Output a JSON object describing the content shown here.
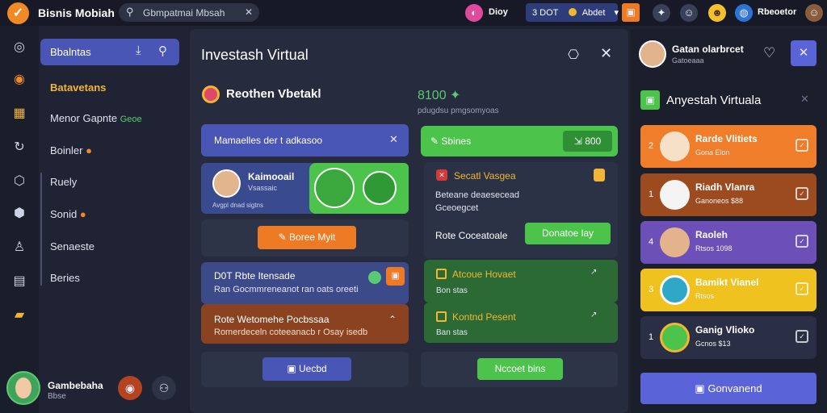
{
  "topbar": {
    "app_title": "Bisnis Mobiah",
    "search_text": "Gbmpatmai Mbsah",
    "user_label": "Dioy",
    "pill_text": "3 DOT",
    "pill_value": "Abdet",
    "right_name": "Rbeoetor"
  },
  "sidebar": {
    "header_label": "Bbalntas",
    "section_title": "Batavetans",
    "items": [
      "Menor Gapnte",
      "Boinler",
      "Ruely",
      "Sonid",
      "Senaeste",
      "Beries"
    ],
    "badge": "Geoe",
    "user_name": "Gambebaha",
    "user_sub": "Bbse"
  },
  "main": {
    "title": "Investash Virtual",
    "subtitle": "Reothen Vbetakl",
    "amount": "8100",
    "amount_sub": "pdugdsu pmgsomyoas",
    "left": {
      "banner": "Mamaelles der t adkasoo",
      "profile_name": "Kaimooail",
      "profile_sub": "Vsassaic",
      "profile_caption": "Avgpl dnad sigtns",
      "orange_button": "Boree Myit",
      "item1_title": "D0T Rbte Itensade",
      "item1_sub": "Ran Gocmmreneanot ran oats oreeti",
      "item2_title": "Rote Wetomehe Pocbssaa",
      "item2_sub": "Romerdeceln coteeanacb r Osay isedb",
      "bottom_button": "Uecbd"
    },
    "right": {
      "green_header": "Sbines",
      "green_header_value": "800",
      "special_title": "Secatl Vasgea",
      "special_sub1": "Beteane deaesecead",
      "special_sub2": "Gceoegcet",
      "rate_label": "Rote Coceatoale",
      "rate_button": "Donatoe lay",
      "task1_title": "Atcoue Hovaet",
      "task1_sub": "Bon stas",
      "task2_title": "Kontnd Pesent",
      "task2_sub": "Ban stas",
      "bottom_button": "Nccoet bins"
    }
  },
  "rpanel": {
    "profile_name": "Gatan olarbrcet",
    "profile_sub": "Gatoeaaa",
    "header_title": "Anyestah Virtuala",
    "cards": [
      {
        "num": "2",
        "title": "Rarde Vlitiets",
        "sub": "Gona Elon",
        "color": "#ef7d2a"
      },
      {
        "num": "1",
        "title": "Riadh Vlanra",
        "sub": "Ganoneos $88",
        "color": "#9c4a1f"
      },
      {
        "num": "4",
        "title": "Raoleh",
        "sub": "Rtsos 1098",
        "color": "#6d4fb8"
      },
      {
        "num": "3",
        "title": "Bamikt Vianel",
        "sub": "Rtsos",
        "color": "#f0c21f"
      },
      {
        "num": "1",
        "title": "Ganig Vlioko",
        "sub": "Gcnos $13",
        "color": "#2a2f45"
      }
    ],
    "bottom_button": "Gonvanend"
  }
}
